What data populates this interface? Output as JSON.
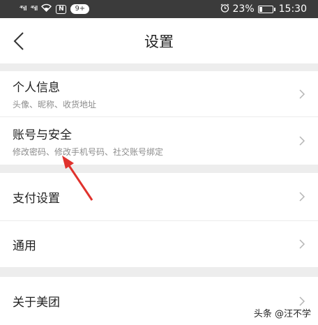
{
  "status_bar": {
    "signal_1": "⁴⁶ıll",
    "signal_2": "⁴⁶ıll",
    "nfc": "N",
    "badge": "9+",
    "battery_percent": "23%",
    "battery_level": 0.23,
    "time": "15:30"
  },
  "header": {
    "title": "设置"
  },
  "menu": {
    "personal_info": {
      "title": "个人信息",
      "subtitle": "头像、昵称、收货地址"
    },
    "account_security": {
      "title": "账号与安全",
      "subtitle": "修改密码、修改手机号码、社交账号绑定"
    },
    "payment": {
      "title": "支付设置"
    },
    "general": {
      "title": "通用"
    },
    "about": {
      "title": "关于美团"
    }
  },
  "watermark": "头条 @汪不学",
  "colors": {
    "status_bar_bg": "#3b3b3b",
    "annotation_arrow": "#e0322d",
    "chevron": "#b5b5b5"
  }
}
